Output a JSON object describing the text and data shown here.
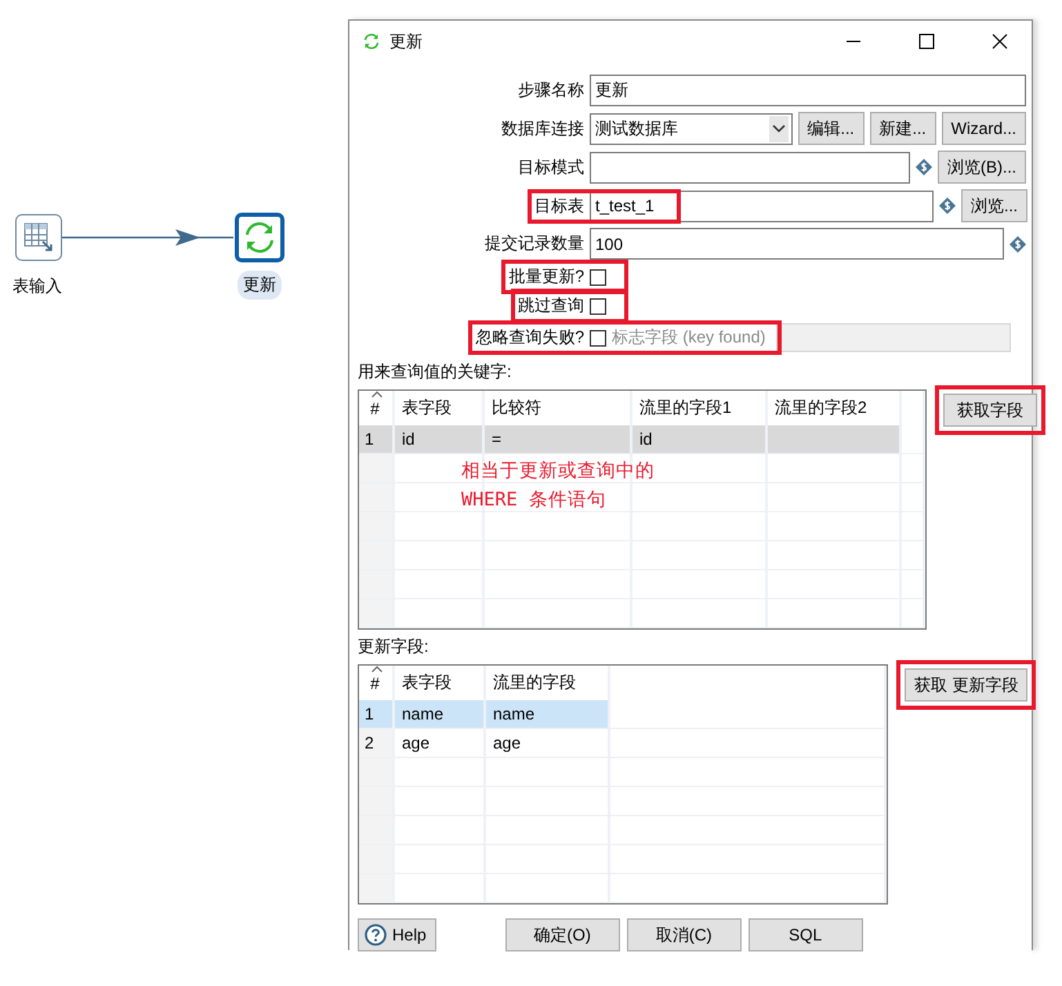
{
  "canvas": {
    "nodes": [
      {
        "label": "表输入",
        "kind": "table-input",
        "selected": false
      },
      {
        "label": "更新",
        "kind": "update",
        "selected": true
      }
    ]
  },
  "window": {
    "title": "更新"
  },
  "form": {
    "fields": [
      {
        "kind": "text",
        "label": "步骤名称",
        "value": "更新",
        "highlighted": false
      },
      {
        "kind": "select",
        "label": "数据库连接",
        "value": "测试数据库",
        "buttons": [
          "编辑...",
          "新建...",
          "Wizard..."
        ],
        "highlighted": false
      },
      {
        "kind": "text",
        "label": "目标模式",
        "variable": true,
        "buttons": [
          "浏览(B)..."
        ],
        "highlighted": false
      },
      {
        "kind": "text",
        "label": "目标表",
        "value": "t_test_1",
        "variable": true,
        "buttons": [
          "浏览..."
        ],
        "highlighted": true
      },
      {
        "kind": "text",
        "label": "提交记录数量",
        "value": "100",
        "variable": true,
        "highlighted": false
      },
      {
        "kind": "checkbox",
        "label": "批量更新?",
        "checked": false,
        "highlighted": true
      },
      {
        "kind": "checkbox",
        "label": "跳过查询",
        "checked": false,
        "highlighted": true
      },
      {
        "kind": "checkbox",
        "label": "忽略查询失败?",
        "checked": false,
        "highlighted": true,
        "flag": {
          "label": "标志字段 (key found)",
          "disabled": true
        }
      }
    ]
  },
  "key_table": {
    "label": "用来查询值的关键字:",
    "focused": false,
    "columns": [
      "#",
      "表字段",
      "比较符",
      "流里的字段1",
      "流里的字段2"
    ],
    "rows": [
      {
        "cells": [
          "1",
          "id",
          "=",
          "id"
        ],
        "selected": true
      }
    ],
    "annotation": [
      "相当于更新或查询中的",
      "WHERE 条件语句"
    ],
    "button": {
      "label": "获取字段",
      "highlighted": true
    }
  },
  "update_table": {
    "label": "更新字段:",
    "focused": true,
    "columns": [
      "#",
      "表字段",
      "流里的字段"
    ],
    "rows": [
      {
        "cells": [
          "1",
          "name",
          "name"
        ],
        "selected": true
      },
      {
        "cells": [
          "2",
          "age",
          "age"
        ],
        "selected": false
      }
    ],
    "button": {
      "label": "获取 更新字段",
      "highlighted": true
    }
  },
  "footer": {
    "help": "Help",
    "buttons": [
      "确定(O)",
      "取消(C)",
      "SQL"
    ]
  }
}
